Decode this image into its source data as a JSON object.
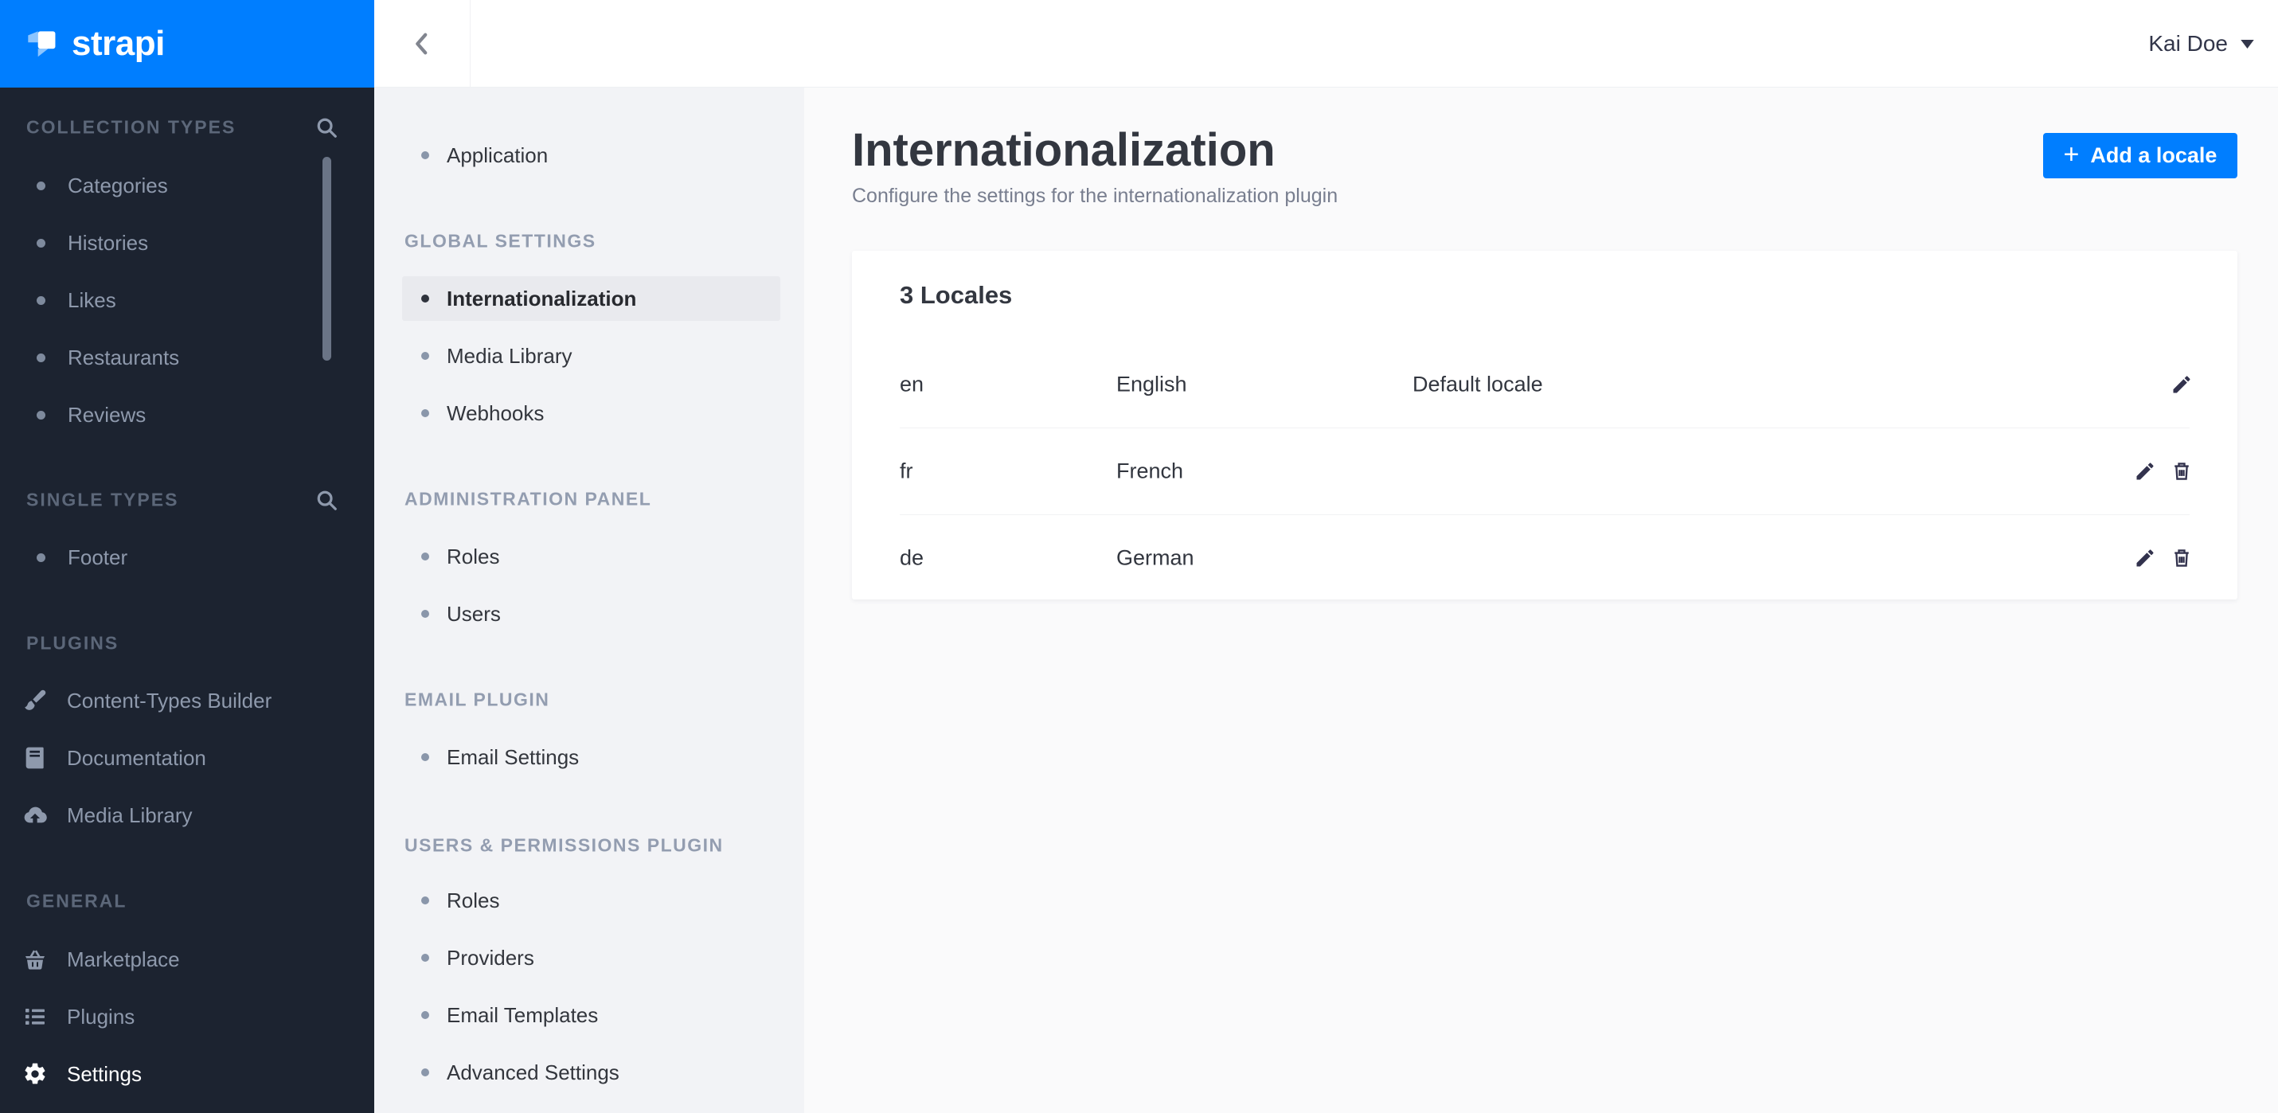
{
  "brand": {
    "name": "strapi"
  },
  "header": {
    "user_name": "Kai Doe"
  },
  "sidebar": {
    "sections": [
      {
        "label": "COLLECTION TYPES",
        "has_search": true,
        "items": [
          {
            "label": "Categories"
          },
          {
            "label": "Histories"
          },
          {
            "label": "Likes"
          },
          {
            "label": "Restaurants"
          },
          {
            "label": "Reviews"
          }
        ]
      },
      {
        "label": "SINGLE TYPES",
        "has_search": true,
        "items": [
          {
            "label": "Footer"
          }
        ]
      },
      {
        "label": "PLUGINS",
        "items": [
          {
            "label": "Content-Types Builder",
            "icon": "paintbrush-icon"
          },
          {
            "label": "Documentation",
            "icon": "book-icon"
          },
          {
            "label": "Media Library",
            "icon": "cloud-upload-icon"
          }
        ]
      },
      {
        "label": "GENERAL",
        "items": [
          {
            "label": "Marketplace",
            "icon": "basket-icon"
          },
          {
            "label": "Plugins",
            "icon": "list-icon"
          },
          {
            "label": "Settings",
            "icon": "gear-icon",
            "active": true
          }
        ]
      }
    ]
  },
  "settings_nav": {
    "standalone": {
      "label": "Application"
    },
    "sections": [
      {
        "label": "GLOBAL SETTINGS",
        "items": [
          {
            "label": "Internationalization",
            "active": true
          },
          {
            "label": "Media Library"
          },
          {
            "label": "Webhooks"
          }
        ]
      },
      {
        "label": "ADMINISTRATION PANEL",
        "items": [
          {
            "label": "Roles"
          },
          {
            "label": "Users"
          }
        ]
      },
      {
        "label": "EMAIL PLUGIN",
        "items": [
          {
            "label": "Email Settings"
          }
        ]
      },
      {
        "label": "USERS & PERMISSIONS PLUGIN",
        "items": [
          {
            "label": "Roles"
          },
          {
            "label": "Providers"
          },
          {
            "label": "Email Templates"
          },
          {
            "label": "Advanced Settings"
          }
        ]
      }
    ]
  },
  "main": {
    "title": "Internationalization",
    "subtitle": "Configure the settings for the internationalization plugin",
    "add_locale_button": {
      "plus": "+",
      "label": "Add a locale"
    },
    "card": {
      "title": "3 Locales",
      "rows": [
        {
          "code": "en",
          "name": "English",
          "badge": "Default locale",
          "can_delete": false
        },
        {
          "code": "fr",
          "name": "French",
          "badge": "",
          "can_delete": true
        },
        {
          "code": "de",
          "name": "German",
          "badge": "",
          "can_delete": true
        }
      ]
    }
  },
  "colors": {
    "primary": "#007eff",
    "sidebar_bg": "#1c2330",
    "settings_sidebar_bg": "#f2f3f6",
    "selected_item_bg": "#e9eaee",
    "main_bg": "#fafafb"
  }
}
